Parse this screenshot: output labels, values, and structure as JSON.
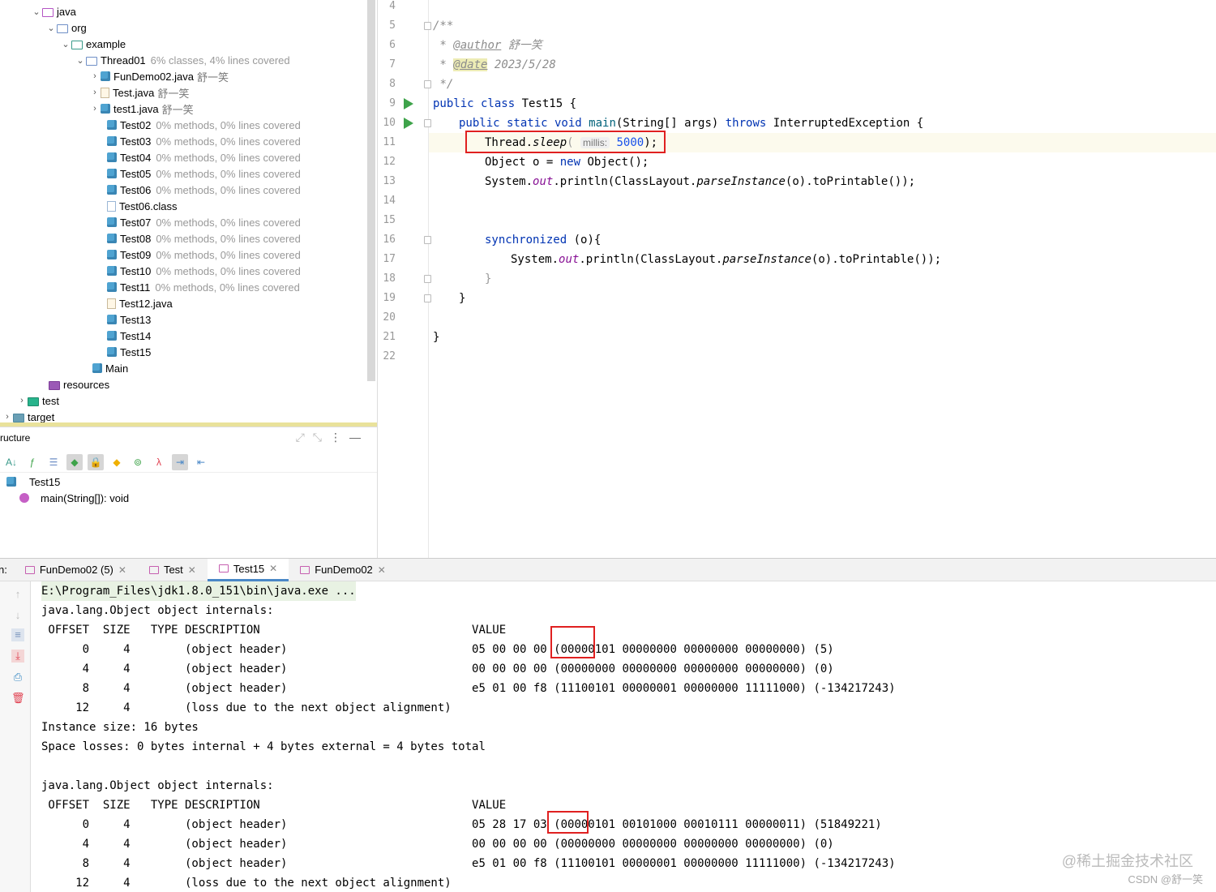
{
  "project_tree": {
    "items": [
      {
        "label": "java",
        "arrow": "⌄"
      },
      {
        "label": "org",
        "arrow": "⌄"
      },
      {
        "label": "example",
        "arrow": "⌄"
      },
      {
        "label": "Thread01",
        "arrow": "⌄",
        "coverage": "6% classes, 4% lines covered"
      },
      {
        "label": "FunDemo02.java",
        "arrow": "›",
        "author": "舒一笑"
      },
      {
        "label": "Test.java",
        "arrow": "›",
        "author": "舒一笑"
      },
      {
        "label": "test1.java",
        "arrow": "›",
        "author": "舒一笑"
      },
      {
        "label": "Test02",
        "coverage": "0% methods, 0% lines covered"
      },
      {
        "label": "Test03",
        "coverage": "0% methods, 0% lines covered"
      },
      {
        "label": "Test04",
        "coverage": "0% methods, 0% lines covered"
      },
      {
        "label": "Test05",
        "coverage": "0% methods, 0% lines covered"
      },
      {
        "label": "Test06",
        "coverage": "0% methods, 0% lines covered"
      },
      {
        "label": "Test06.class"
      },
      {
        "label": "Test07",
        "coverage": "0% methods, 0% lines covered"
      },
      {
        "label": "Test08",
        "coverage": "0% methods, 0% lines covered"
      },
      {
        "label": "Test09",
        "coverage": "0% methods, 0% lines covered"
      },
      {
        "label": "Test10",
        "coverage": "0% methods, 0% lines covered"
      },
      {
        "label": "Test11",
        "coverage": "0% methods, 0% lines covered"
      },
      {
        "label": "Test12.java"
      },
      {
        "label": "Test13"
      },
      {
        "label": "Test14"
      },
      {
        "label": "Test15"
      },
      {
        "label": "Main"
      },
      {
        "label": "resources"
      },
      {
        "label": "test",
        "arrow": "›"
      },
      {
        "label": "target",
        "arrow": "›"
      }
    ]
  },
  "structure": {
    "title": "ructure",
    "root": "Test15",
    "method": "main(String[]): void"
  },
  "editor": {
    "line_numbers": [
      "4",
      "5",
      "6",
      "7",
      "8",
      "9",
      "10",
      "11",
      "12",
      "13",
      "14",
      "15",
      "16",
      "17",
      "18",
      "19",
      "20",
      "21",
      "22"
    ],
    "doc_open": "/**",
    "author_tag": "@author",
    "author_name": "舒一笑",
    "date_tag": "@date",
    "date_value": "2023/5/28",
    "doc_close": "*/",
    "class_decl": [
      "public class ",
      "Test15 {"
    ],
    "main_decl": [
      "public static void ",
      "main",
      "(String[] args) ",
      "throws",
      " InterruptedException {"
    ],
    "sleep_line": [
      "Thread.",
      "sleep",
      "(",
      "millis:",
      "5000",
      ");"
    ],
    "object_line": [
      "Object o = ",
      "new",
      " Object();"
    ],
    "print_line": [
      "System.",
      "out",
      ".println(ClassLayout.",
      "parseInstance",
      "(o).toPrintable());"
    ],
    "sync_line": [
      "synchronized",
      " (o){"
    ],
    "print_line2": [
      "System.",
      "out",
      ".println(ClassLayout.",
      "parseInstance",
      "(o).toPrintable());"
    ],
    "close_sync": "}",
    "close_main": "}",
    "close_class": "}"
  },
  "run_panel": {
    "label": "n:",
    "tabs": [
      {
        "label": "FunDemo02 (5)",
        "closable": true
      },
      {
        "label": "Test",
        "closable": true
      },
      {
        "label": "Test15",
        "closable": true,
        "active": true
      },
      {
        "label": "FunDemo02",
        "closable": true
      }
    ],
    "console_lines": [
      "E:\\Program_Files\\jdk1.8.0_151\\bin\\java.exe ...",
      "java.lang.Object object internals:",
      " OFFSET  SIZE   TYPE DESCRIPTION                               VALUE",
      "      0     4        (object header)                           05 00 00 00 (00000101 00000000 00000000 00000000) (5)",
      "      4     4        (object header)                           00 00 00 00 (00000000 00000000 00000000 00000000) (0)",
      "      8     4        (object header)                           e5 01 00 f8 (11100101 00000001 00000000 11111000) (-134217243)",
      "     12     4        (loss due to the next object alignment)",
      "Instance size: 16 bytes",
      "Space losses: 0 bytes internal + 4 bytes external = 4 bytes total",
      "",
      "java.lang.Object object internals:",
      " OFFSET  SIZE   TYPE DESCRIPTION                               VALUE",
      "      0     4        (object header)                           05 28 17 03 (00000101 00101000 00010111 00000011) (51849221)",
      "      4     4        (object header)                           00 00 00 00 (00000000 00000000 00000000 00000000) (0)",
      "      8     4        (object header)                           e5 01 00 f8 (11100101 00000001 00000000 11111000) (-134217243)",
      "     12     4        (loss due to the next object alignment)"
    ]
  },
  "watermark": {
    "line1": "@稀土掘金技术社区",
    "line2": "CSDN @舒一笑"
  }
}
